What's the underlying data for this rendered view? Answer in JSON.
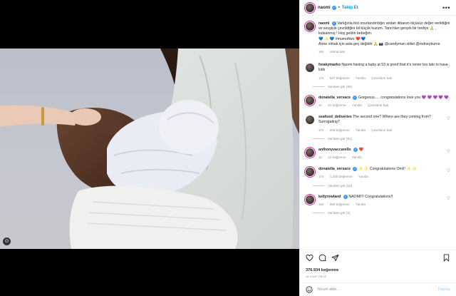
{
  "post": {
    "username": "naomi",
    "follow_label": "Takip Et",
    "more_label": "•••",
    "caption": {
      "text1": "Varlığınla bizi onurlandırdığın andan itibaren ölçüsüz değer verildiğini ve sevgiyle çevrildiğini bil küçük kuzum. Tanrı'dan gerçek bir hediye 🙏 , kutsanmış ! Hoş geldin bebeğim.",
      "text2": "💙 ✨ 💙 #mumoftwo ❤️ 💙",
      "text3": "Anne olmak için asla geç değildir 🙏 📷 @candyman stilist @rodneyburns",
      "time": "18s",
      "see_translation": "Aslına bak"
    },
    "comments": [
      {
        "user": "freakymarko",
        "text": "Naomi having a baby at 53 is proof that it's never too late to have kids",
        "time": "17s",
        "likes": "637 beğenme",
        "reply": "Yanıtla",
        "translate": "Çevirisine bak",
        "view_replies": "Yanıtları gör (80)"
      },
      {
        "user": "donatella_versace",
        "text": "Gorgeous..... congratulations love you 💜 💜 💜 💜 💜",
        "time": "1s",
        "likes": "41 beğenme",
        "reply": "Yanıtla",
        "translate": "Çevirisine bak",
        "view_replies": ""
      },
      {
        "user": "seafood_deliveries",
        "text": "The second one? Where are they coming from? Surrogating?",
        "time": "17s",
        "likes": "206 beğenme",
        "reply": "Yanıtla",
        "translate": "Çevirisine bak",
        "view_replies": "Yanıtları gör (61)"
      },
      {
        "user": "anthonyvaccarello",
        "text": "❤️",
        "time": "1s",
        "likes": "12 beğenme",
        "reply": "Yanıtla",
        "translate": "",
        "view_replies": ""
      },
      {
        "user": "donatella_versace",
        "text": "✨ ✨ Congratulations Omi!! ✨ ✨",
        "time": "17s",
        "likes": "1.340 beğenme",
        "reply": "Yanıtla",
        "translate": "",
        "view_replies": "Yanıtları gör (10)"
      },
      {
        "user": "kellyrowland",
        "text": "NAOMI!!! Congratulations!!",
        "time": "16s",
        "likes": "956 beğenme",
        "reply": "Yanıtla",
        "translate": "",
        "view_replies": "Yanıtları gör (2)"
      }
    ],
    "likes_count": "376.934 beğenme",
    "date": "18 SAAT ÖNCE",
    "add_comment_placeholder": "Yorum ekle...",
    "post_button": "Paylaş"
  },
  "icons": {
    "like": "heart-icon",
    "comment": "comment-icon",
    "share": "share-icon",
    "save": "bookmark-icon",
    "emoji": "smiley-icon",
    "media": "multiple-media-icon"
  },
  "colors": {
    "verified": "#3897f0",
    "follow": "#0095f6",
    "secondary_text": "#8e8e8e"
  }
}
